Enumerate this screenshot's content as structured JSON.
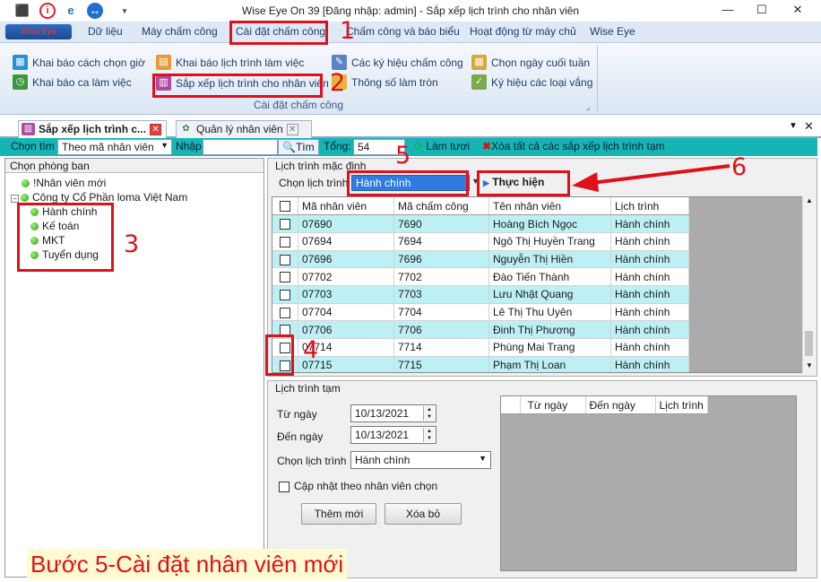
{
  "titlebar": {
    "title": "Wise Eye On 39 [Đăng nhập: admin] - Sắp xếp lịch trình cho nhân viên"
  },
  "menu": {
    "logo": "Wise Eye",
    "items": [
      "Dữ liệu",
      "Máy chấm công",
      "Cài đặt chấm công",
      "Chấm công và báo biểu",
      "Hoạt động từ máy chủ",
      "Wise Eye"
    ]
  },
  "ribbon": {
    "buttons": [
      "Khai báo cách chọn giờ",
      "Khai báo ca làm việc",
      "Khai báo lịch trình làm việc",
      "Sắp xếp lịch trình cho nhân viên",
      "Các ký hiệu chấm công",
      "Thông số làm tròn",
      "Chọn ngày cuối tuần",
      "Ký hiệu các loại vắng"
    ],
    "group_label": "Cài đặt chấm công"
  },
  "tabs": [
    "Sắp xếp lịch trình c...",
    "Quản lý nhân viên"
  ],
  "toolbar": {
    "search_label": "Chọn tìm",
    "search_mode": "Theo mã nhân viên",
    "input_label": "Nhập",
    "input_value": "",
    "search_button": "Tìm",
    "total_label": "Tổng:",
    "total_value": "54",
    "refresh_button": "Làm tươi",
    "delete_all_button": "Xóa tất cả các sắp xếp lịch trình tạm"
  },
  "left": {
    "header": "Chọn phòng ban",
    "tree": {
      "new_staff": "!Nhân viên mới",
      "company": "Công ty Cổ Phần loma Việt Nam",
      "departments": [
        "Hành chính",
        "Kế toán",
        "MKT",
        "Tuyển dụng"
      ]
    }
  },
  "schedule": {
    "group_label": "Lịch trình mặc định",
    "select_label": "Chọn lịch trình",
    "select_value": "Hành chính",
    "execute_button": "Thực hiện",
    "columns": [
      "Mã nhân viên",
      "Mã chấm công",
      "Tên nhân viên",
      "Lịch trình"
    ],
    "rows": [
      {
        "id": "07690",
        "code": "7690",
        "name": "Hoàng Bích Ngọc",
        "schedule": "Hành chính"
      },
      {
        "id": "07694",
        "code": "7694",
        "name": "Ngô Thị Huyền Trang",
        "schedule": "Hành chính"
      },
      {
        "id": "07696",
        "code": "7696",
        "name": "Nguyễn Thị Hiền",
        "schedule": "Hành chính"
      },
      {
        "id": "07702",
        "code": "7702",
        "name": "Đào Tiến Thành",
        "schedule": "Hành chính"
      },
      {
        "id": "07703",
        "code": "7703",
        "name": "Lưu Nhật Quang",
        "schedule": "Hành chính"
      },
      {
        "id": "07704",
        "code": "7704",
        "name": "Lê Thị Thu Uyên",
        "schedule": "Hành chính"
      },
      {
        "id": "07706",
        "code": "7706",
        "name": "Đinh Thị Phương",
        "schedule": "Hành chính"
      },
      {
        "id": "07714",
        "code": "7714",
        "name": "Phùng Mai Trang",
        "schedule": "Hành chính"
      },
      {
        "id": "07715",
        "code": "7715",
        "name": "Phạm Thị Loan",
        "schedule": "Hành chính"
      }
    ]
  },
  "temp": {
    "group_label": "Lịch trình tạm",
    "from_label": "Từ ngày",
    "from_value": "10/13/2021",
    "to_label": "Đến ngày",
    "to_value": "10/13/2021",
    "select_label": "Chọn lịch trình",
    "select_value": "Hành chính",
    "checkbox_label": "Cập nhật theo nhân viên chọn",
    "add_button": "Thêm mới",
    "delete_button": "Xóa bỏ",
    "columns": [
      "Từ ngày",
      "Đến ngày",
      "Lịch trình"
    ]
  },
  "annotations": {
    "numbers": [
      "1",
      "2",
      "3",
      "4",
      "5",
      "6"
    ],
    "caption": "Bước 5-Cài đặt nhân viên mới",
    "color": "#e0101a"
  }
}
